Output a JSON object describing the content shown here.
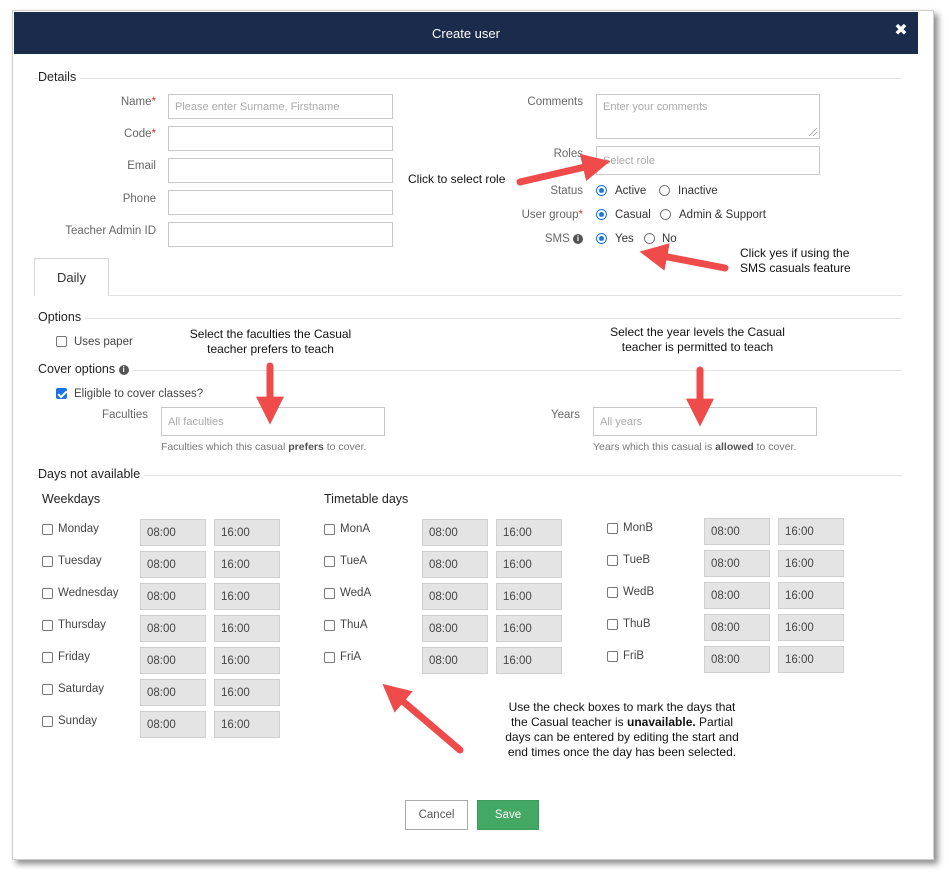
{
  "dialog": {
    "title": "Create user",
    "close_icon": "close-icon"
  },
  "details": {
    "legend": "Details",
    "name": {
      "label": "Name",
      "required_mark": "*",
      "placeholder": "Please enter Surname, Firstname"
    },
    "code": {
      "label": "Code",
      "required_mark": "*"
    },
    "email": {
      "label": "Email"
    },
    "phone": {
      "label": "Phone"
    },
    "teacher_admin_id": {
      "label": "Teacher Admin ID"
    },
    "comments": {
      "label": "Comments",
      "placeholder": "Enter your comments"
    },
    "roles": {
      "label": "Roles",
      "placeholder": "Select role"
    },
    "status": {
      "label": "Status",
      "options": [
        "Active",
        "Inactive"
      ],
      "selected": "Active"
    },
    "user_group": {
      "label": "User group",
      "required_mark": "*",
      "options": [
        "Casual",
        "Admin & Support"
      ],
      "selected": "Casual"
    },
    "sms": {
      "label": "SMS",
      "info_icon": "info-icon",
      "options": [
        "Yes",
        "No"
      ],
      "selected": "Yes"
    }
  },
  "tabs": [
    {
      "label": "Daily",
      "active": true
    }
  ],
  "options": {
    "legend": "Options",
    "uses_paper": {
      "label": "Uses paper",
      "checked": false
    }
  },
  "cover_options": {
    "legend": "Cover options",
    "info_icon": "info-icon",
    "eligible": {
      "label": "Eligible to cover classes?",
      "checked": true
    },
    "faculties": {
      "label": "Faculties",
      "placeholder": "All faculties",
      "help_pre": "Faculties which this casual ",
      "help_bold": "prefers",
      "help_post": " to cover."
    },
    "years": {
      "label": "Years",
      "placeholder": "All years",
      "help_pre": "Years which this casual is ",
      "help_bold": "allowed",
      "help_post": " to cover."
    }
  },
  "days_not_available": {
    "legend": "Days not available",
    "weekdays_heading": "Weekdays",
    "timetable_heading": "Timetable days",
    "weekdays": [
      {
        "label": "Monday",
        "start": "08:00",
        "end": "16:00"
      },
      {
        "label": "Tuesday",
        "start": "08:00",
        "end": "16:00"
      },
      {
        "label": "Wednesday",
        "start": "08:00",
        "end": "16:00"
      },
      {
        "label": "Thursday",
        "start": "08:00",
        "end": "16:00"
      },
      {
        "label": "Friday",
        "start": "08:00",
        "end": "16:00"
      },
      {
        "label": "Saturday",
        "start": "08:00",
        "end": "16:00"
      },
      {
        "label": "Sunday",
        "start": "08:00",
        "end": "16:00"
      }
    ],
    "timetable_a": [
      {
        "label": "MonA",
        "start": "08:00",
        "end": "16:00"
      },
      {
        "label": "TueA",
        "start": "08:00",
        "end": "16:00"
      },
      {
        "label": "WedA",
        "start": "08:00",
        "end": "16:00"
      },
      {
        "label": "ThuA",
        "start": "08:00",
        "end": "16:00"
      },
      {
        "label": "FriA",
        "start": "08:00",
        "end": "16:00"
      }
    ],
    "timetable_b": [
      {
        "label": "MonB",
        "start": "08:00",
        "end": "16:00"
      },
      {
        "label": "TueB",
        "start": "08:00",
        "end": "16:00"
      },
      {
        "label": "WedB",
        "start": "08:00",
        "end": "16:00"
      },
      {
        "label": "ThuB",
        "start": "08:00",
        "end": "16:00"
      },
      {
        "label": "FriB",
        "start": "08:00",
        "end": "16:00"
      }
    ]
  },
  "buttons": {
    "cancel": "Cancel",
    "save": "Save"
  },
  "annotations": {
    "role": "Click to select role",
    "sms_1": "Click yes if using the",
    "sms_2": "SMS casuals feature",
    "faculties_1": "Select the faculties the Casual",
    "faculties_2": "teacher prefers to teach",
    "years_1": "Select the year levels the Casual",
    "years_2": "teacher is permitted to teach",
    "days_1": "Use the check boxes to mark the days that",
    "days_2_pre": "the Casual teacher is ",
    "days_2_bold": "unavailable.",
    "days_2_post": " Partial",
    "days_3": "days can be entered by editing the start and",
    "days_4": "end times once the day has been selected."
  },
  "colors": {
    "titlebar": "#1b2b4b",
    "accent": "#1a73e8",
    "save": "#44a865",
    "arrow": "#ef4b4b",
    "required": "#c0392b"
  }
}
